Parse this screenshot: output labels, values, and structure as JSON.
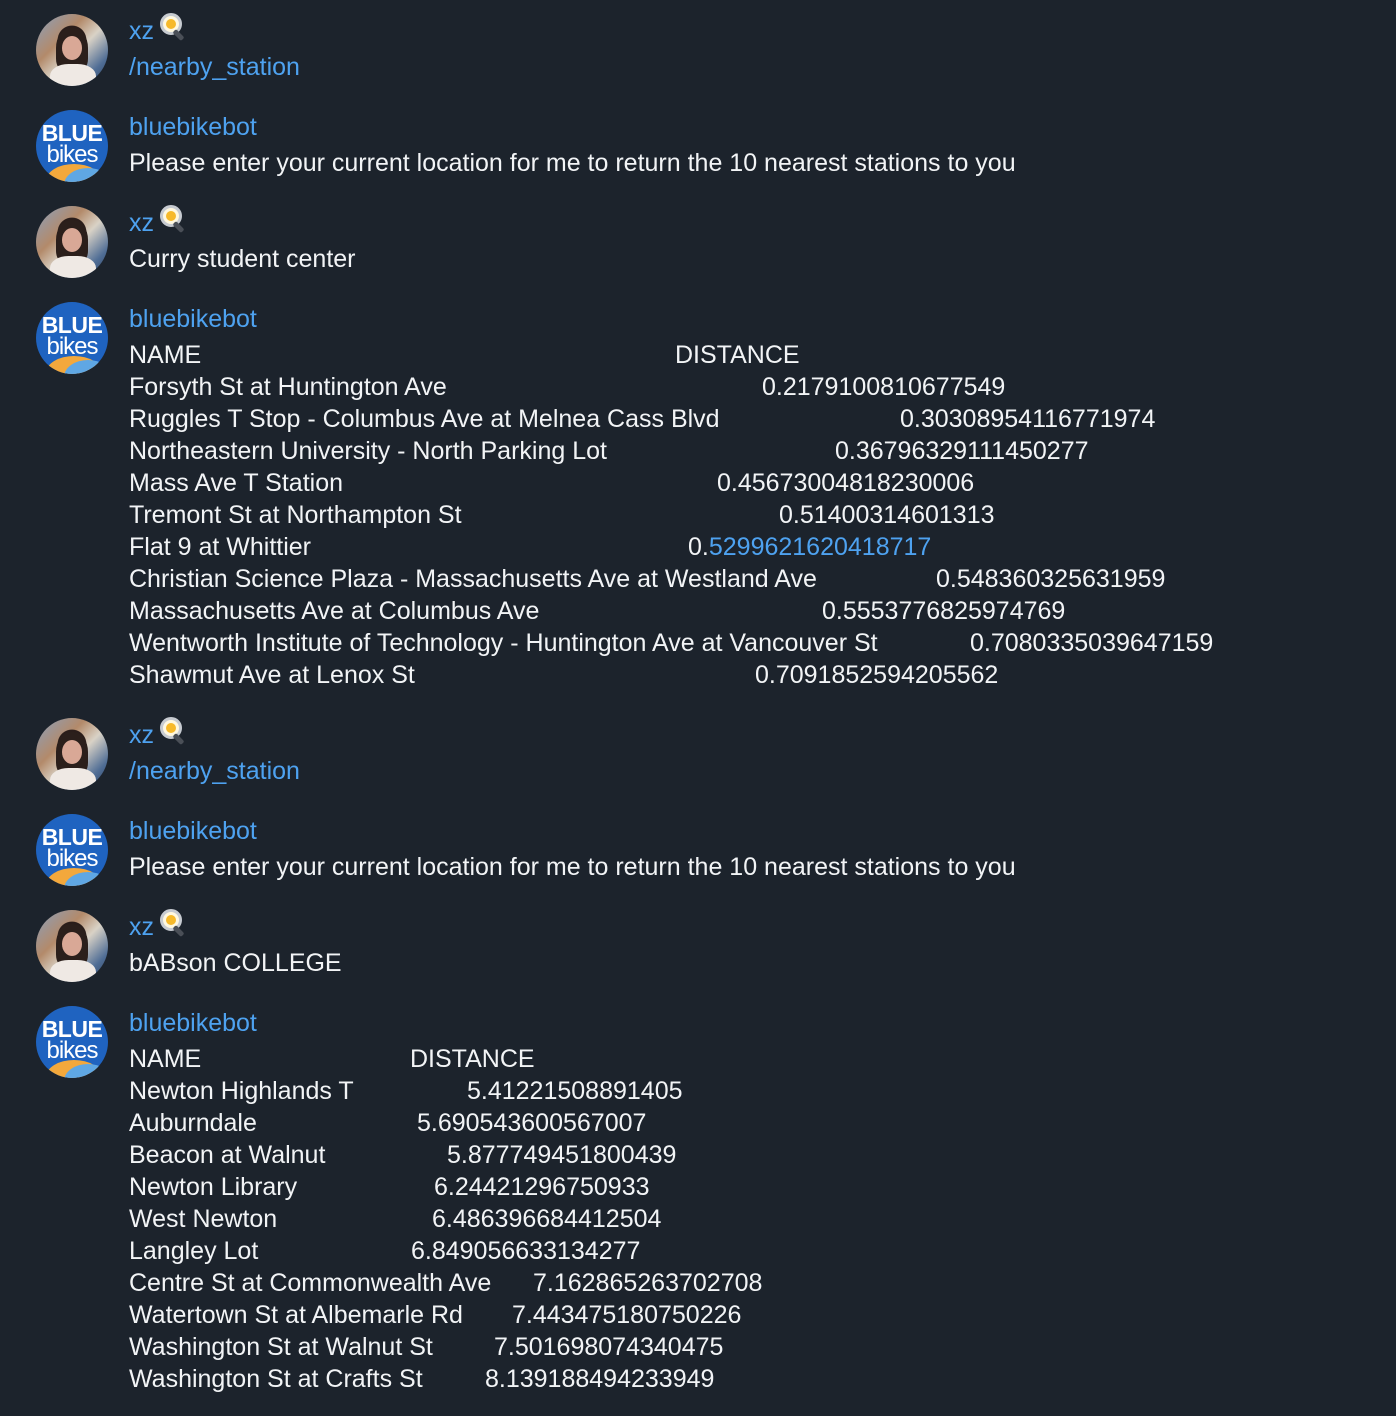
{
  "messages": [
    {
      "sender": "xz",
      "text": "/nearby_station"
    },
    {
      "sender": "bluebikebot",
      "text": "Please enter your current location for me to return the 10 nearest stations to you"
    },
    {
      "sender": "xz",
      "text": "Curry student center"
    },
    {
      "sender": "bluebikebot",
      "table": {
        "header": {
          "name": "NAME",
          "distance": "DISTANCE"
        },
        "rows": [
          {
            "name": "Forsyth St at Huntington Ave",
            "distance": "0.2179100810677549"
          },
          {
            "name": "Ruggles T Stop - Columbus Ave at Melnea Cass Blvd",
            "distance": "0.30308954116771974"
          },
          {
            "name": "Northeastern University - North Parking Lot",
            "distance": "0.36796329111450277"
          },
          {
            "name": "Mass Ave T Station",
            "distance": "0.45673004818230006"
          },
          {
            "name": "Tremont St at Northampton St",
            "distance": "0.51400314601313"
          },
          {
            "name": "Flat 9 at Whittier",
            "distance_prefix": "0.",
            "distance_link": "5299621620418717"
          },
          {
            "name": "Christian Science Plaza - Massachusetts Ave at Westland Ave",
            "distance": "0.548360325631959"
          },
          {
            "name": "Massachusetts Ave at Columbus Ave",
            "distance": "0.5553776825974769"
          },
          {
            "name": "Wentworth Institute of Technology - Huntington Ave at Vancouver St",
            "distance": "0.7080335039647159"
          },
          {
            "name": "Shawmut Ave at Lenox St",
            "distance": "0.7091852594205562"
          }
        ]
      }
    },
    {
      "sender": "xz",
      "text": "/nearby_station"
    },
    {
      "sender": "bluebikebot",
      "text": "Please enter your current location for me to return the 10 nearest stations to you"
    },
    {
      "sender": "xz",
      "text": "bABson COLLEGE"
    },
    {
      "sender": "bluebikebot",
      "table": {
        "header": {
          "name": "NAME",
          "distance": "DISTANCE"
        },
        "rows": [
          {
            "name": "Newton Highlands T",
            "distance": "5.41221508891405"
          },
          {
            "name": "Auburndale",
            "distance": "5.690543600567007"
          },
          {
            "name": "Beacon at Walnut",
            "distance": "5.877749451800439"
          },
          {
            "name": "Newton Library",
            "distance": "6.24421296750933"
          },
          {
            "name": "West Newton",
            "distance": "6.486396684412504"
          },
          {
            "name": "Langley Lot",
            "distance": "6.849056633134277"
          },
          {
            "name": "Centre St at Commonwealth Ave",
            "distance": "7.162865263702708"
          },
          {
            "name": "Watertown St at Albemarle Rd",
            "distance": "7.443475180750226"
          },
          {
            "name": "Washington St at Walnut St",
            "distance": "7.501698074340475"
          },
          {
            "name": "Washington St at Crafts St",
            "distance": "8.139188494233949"
          }
        ]
      }
    }
  ],
  "bot_logo": {
    "line1": "BLUE",
    "line2": "bikes"
  },
  "user_emoji": "frying-pan-egg-icon",
  "colors": {
    "background": "#1c232c",
    "accent": "#4ea2f0",
    "text": "#f2f4f6"
  }
}
